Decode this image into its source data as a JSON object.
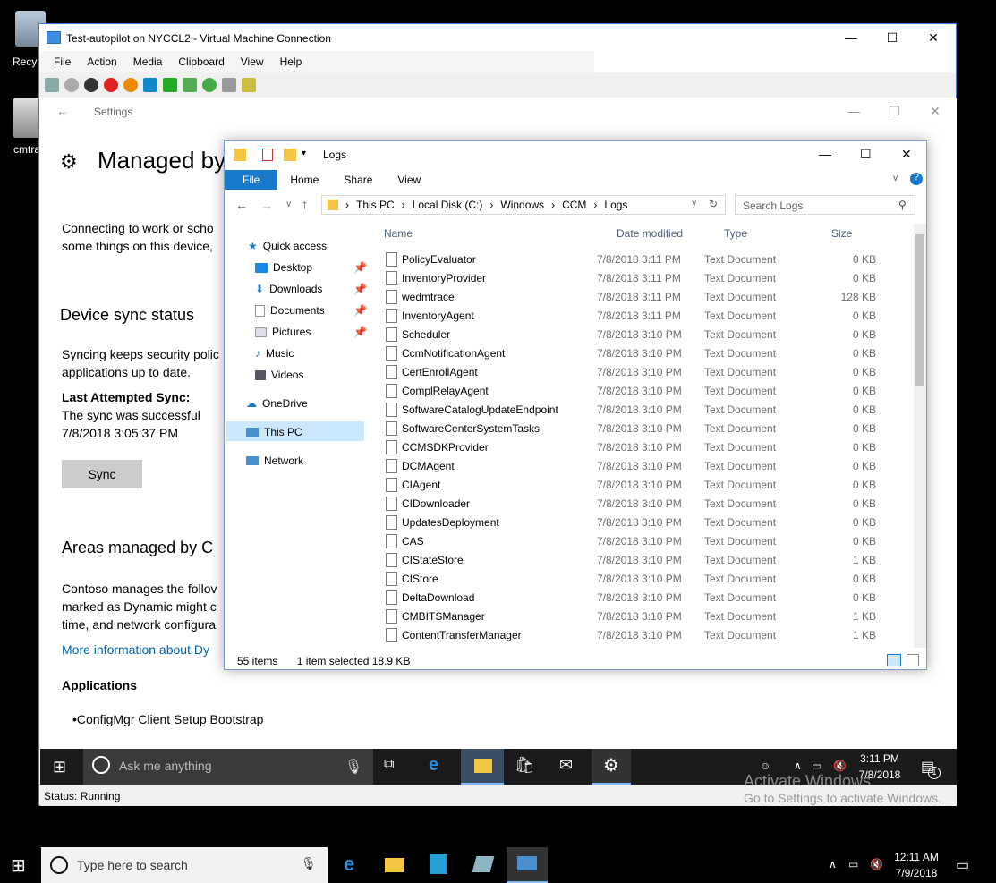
{
  "desktop": {
    "icons": [
      {
        "label": "Recycle",
        "name": "recycle-bin-icon"
      },
      {
        "label": "cmtra",
        "name": "cmtrace-icon"
      }
    ]
  },
  "vm_window": {
    "title": "Test-autopilot on NYCCL2 - Virtual Machine Connection",
    "menu": [
      "File",
      "Action",
      "Media",
      "Clipboard",
      "View",
      "Help"
    ],
    "status": "Status: Running"
  },
  "settings": {
    "window_title": "Settings",
    "heading": "Managed by",
    "intro_line1": "Connecting to work or scho",
    "intro_line2": "some things on this device,",
    "sync_heading": "Device sync status",
    "sync_desc1": "Syncing keeps security polic",
    "sync_desc2": "applications up to date.",
    "last_sync_label": "Last Attempted Sync:",
    "sync_result": "The sync was successful",
    "sync_time": "7/8/2018 3:05:37 PM",
    "sync_button": "Sync",
    "areas_heading": "Areas managed by C",
    "areas_line1": "Contoso manages the follov",
    "areas_line2": "marked as Dynamic might c",
    "areas_line3": "time, and network configura",
    "more_info_link": "More information about Dy",
    "apps_heading": "Applications",
    "app_item": "•ConfigMgr Client Setup Bootstrap"
  },
  "guest_taskbar": {
    "search_placeholder": "Ask me anything",
    "time": "3:11 PM",
    "date": "7/8/2018",
    "notif_count": "1",
    "watermark1": "Activate Windows",
    "watermark2": "Go to Settings to activate Windows."
  },
  "explorer": {
    "title": "Logs",
    "tabs": [
      "File",
      "Home",
      "Share",
      "View"
    ],
    "breadcrumb": [
      "This PC",
      "Local Disk (C:)",
      "Windows",
      "CCM",
      "Logs"
    ],
    "search_placeholder": "Search Logs",
    "nav": [
      {
        "label": "Quick access",
        "icon": "star-icon"
      },
      {
        "label": "Desktop",
        "icon": "desktop-folder-icon"
      },
      {
        "label": "Downloads",
        "icon": "download-arrow-icon"
      },
      {
        "label": "Documents",
        "icon": "documents-icon"
      },
      {
        "label": "Pictures",
        "icon": "pictures-icon"
      },
      {
        "label": "Music",
        "icon": "music-note-icon"
      },
      {
        "label": "Videos",
        "icon": "videos-icon"
      },
      {
        "label": "OneDrive",
        "icon": "cloud-icon"
      },
      {
        "label": "This PC",
        "icon": "computer-icon"
      },
      {
        "label": "Network",
        "icon": "network-icon"
      }
    ],
    "columns": [
      "Name",
      "Date modified",
      "Type",
      "Size"
    ],
    "files": [
      {
        "name": "PolicyEvaluator",
        "date": "7/8/2018 3:11 PM",
        "type": "Text Document",
        "size": "0 KB"
      },
      {
        "name": "InventoryProvider",
        "date": "7/8/2018 3:11 PM",
        "type": "Text Document",
        "size": "0 KB"
      },
      {
        "name": "wedmtrace",
        "date": "7/8/2018 3:11 PM",
        "type": "Text Document",
        "size": "128 KB"
      },
      {
        "name": "InventoryAgent",
        "date": "7/8/2018 3:11 PM",
        "type": "Text Document",
        "size": "0 KB"
      },
      {
        "name": "Scheduler",
        "date": "7/8/2018 3:10 PM",
        "type": "Text Document",
        "size": "0 KB"
      },
      {
        "name": "CcmNotificationAgent",
        "date": "7/8/2018 3:10 PM",
        "type": "Text Document",
        "size": "0 KB"
      },
      {
        "name": "CertEnrollAgent",
        "date": "7/8/2018 3:10 PM",
        "type": "Text Document",
        "size": "0 KB"
      },
      {
        "name": "ComplRelayAgent",
        "date": "7/8/2018 3:10 PM",
        "type": "Text Document",
        "size": "0 KB"
      },
      {
        "name": "SoftwareCatalogUpdateEndpoint",
        "date": "7/8/2018 3:10 PM",
        "type": "Text Document",
        "size": "0 KB"
      },
      {
        "name": "SoftwareCenterSystemTasks",
        "date": "7/8/2018 3:10 PM",
        "type": "Text Document",
        "size": "0 KB"
      },
      {
        "name": "CCMSDKProvider",
        "date": "7/8/2018 3:10 PM",
        "type": "Text Document",
        "size": "0 KB"
      },
      {
        "name": "DCMAgent",
        "date": "7/8/2018 3:10 PM",
        "type": "Text Document",
        "size": "0 KB"
      },
      {
        "name": "CIAgent",
        "date": "7/8/2018 3:10 PM",
        "type": "Text Document",
        "size": "0 KB"
      },
      {
        "name": "CIDownloader",
        "date": "7/8/2018 3:10 PM",
        "type": "Text Document",
        "size": "0 KB"
      },
      {
        "name": "UpdatesDeployment",
        "date": "7/8/2018 3:10 PM",
        "type": "Text Document",
        "size": "0 KB"
      },
      {
        "name": "CAS",
        "date": "7/8/2018 3:10 PM",
        "type": "Text Document",
        "size": "0 KB"
      },
      {
        "name": "CIStateStore",
        "date": "7/8/2018 3:10 PM",
        "type": "Text Document",
        "size": "1 KB"
      },
      {
        "name": "CIStore",
        "date": "7/8/2018 3:10 PM",
        "type": "Text Document",
        "size": "0 KB"
      },
      {
        "name": "DeltaDownload",
        "date": "7/8/2018 3:10 PM",
        "type": "Text Document",
        "size": "0 KB"
      },
      {
        "name": "CMBITSManager",
        "date": "7/8/2018 3:10 PM",
        "type": "Text Document",
        "size": "1 KB"
      },
      {
        "name": "ContentTransferManager",
        "date": "7/8/2018 3:10 PM",
        "type": "Text Document",
        "size": "1 KB"
      }
    ],
    "item_count": "55 items",
    "selection": "1 item selected  18.9 KB"
  },
  "host_taskbar": {
    "search_placeholder": "Type here to search",
    "time": "12:11 AM",
    "date": "7/9/2018"
  },
  "colors": {
    "accent": "#1979ca",
    "selected_nav": "#cce8ff",
    "taskbar": "#1a1a1a"
  }
}
